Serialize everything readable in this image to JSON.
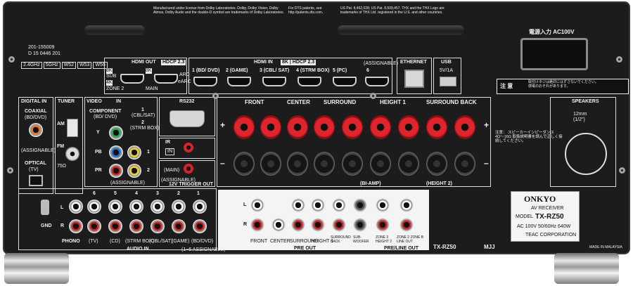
{
  "top": {
    "cert_id": "201-155009",
    "cert_id2": "D 15 0446 201",
    "dolby_notice": "Manufactured under license from Dolby Laboratories. Dolby, Dolby Vision, Dolby Atmos, Dolby Audio and the double-D symbol are trademarks of Dolby Laboratories.",
    "dts_notice": "For DTS patents, see http://patents.dts.com.",
    "thx_notice": "US Pat. 8,462,028; US Pat. 8,509,457. THX and the THX Logo are trademarks of THX Ltd. registered in the U.S. and other countries.",
    "wifi_badges": [
      "2.4GHz",
      "5GHz",
      "W52",
      "W53",
      "W56"
    ]
  },
  "hdmi_out": {
    "label": "HDMI OUT",
    "hdcp": "HDCP 2.3",
    "port_sub": [
      "8K",
      "SUB",
      "4K",
      "ZONE 2"
    ],
    "port_main": [
      "8K",
      "MAIN",
      "ARC",
      "eARC"
    ]
  },
  "hdmi_in": {
    "label": "HDMI IN",
    "tag": "8K | HDCP 2.3",
    "assignable": "(ASSIGNABLE)",
    "ports": [
      "1 (BD/ DVD)",
      "2 (GAME)",
      "3 (CBL/ SAT)",
      "4 (STRM BOX)",
      "5 (PC)",
      "6"
    ]
  },
  "ethernet": {
    "label": "ETHERNET"
  },
  "usb": {
    "label": "USB",
    "rating": "5V/1A"
  },
  "power": {
    "label": "電源入力 AC100V"
  },
  "caution": {
    "title": "注 意",
    "text": "取付けネジは絶対にはずさないでください。感電のおそれがあります。"
  },
  "digital_in": {
    "label": "DIGITAL IN",
    "coaxial": "COAXIAL",
    "coaxial_sub": "(BD/DVD)",
    "assignable": "(ASSIGNABLE)",
    "optical": "OPTICAL",
    "optical_sub": "(TV)"
  },
  "tuner": {
    "label": "TUNER",
    "am": "AM",
    "fm": "FM",
    "ohm": "75Ω"
  },
  "video_in": {
    "label": "VIDEO",
    "label2": "IN",
    "component": "COMPONENT",
    "component_sub": "(BD/ DVD)",
    "in1": "1",
    "in1_sub": "(CBL/SAT)",
    "in2": "2",
    "in2_sub": "(STRM BOX)",
    "y": "Y",
    "pb": "PB",
    "pr": "PR",
    "one": "1",
    "two": "2",
    "assignable": "(ASSIGNABLE)"
  },
  "rs232": {
    "label": "RS232"
  },
  "ir": {
    "label": "IR",
    "in": "IN"
  },
  "trigger": {
    "main": "(MAIN)",
    "assignable": "(ASSIGNABLE)",
    "label": "12V TRIGGER OUT"
  },
  "speakers": {
    "front": "FRONT",
    "center": "CENTER",
    "surround": "SURROUND",
    "height1": "HEIGHT 1",
    "surround_back": "SURROUND BACK",
    "r": "R",
    "l": "L",
    "plus": "+",
    "minus": "–",
    "biamp": "(BI-AMP)",
    "height2": "(HEIGHT 2)",
    "title": "SPEAKERS",
    "wire": "12mm (1/2\")",
    "note": "注意： スピーカーインピーダンス 4Ω〜16Ω 取扱説明書を読んで正しく接続してください。"
  },
  "audio_in": {
    "label": "AUDIO IN",
    "assignable": "(1~6 ASSIGNABLE)",
    "phono": "PHONO",
    "gnd": "GND",
    "numbers": [
      "6",
      "5",
      "4",
      "3",
      "2",
      "1"
    ],
    "names": [
      "(TV)",
      "(CD)",
      "(STRM BOX)",
      "(CBL/SAT)",
      "(GAME)",
      "(BD/DVD)"
    ],
    "l": "L",
    "r": "R"
  },
  "pre_out": {
    "label": "PRE OUT",
    "line_label": "PRE/LINE OUT",
    "channels": [
      "FRONT",
      "CENTER",
      "SURROUND",
      "HEIGHT 1",
      "SURROUND BACK",
      "SUB-WOOFER",
      "ZONE 3 HEIGHT 2",
      "ZONE 2 ZONE B LINE OUT"
    ]
  },
  "model_bottom": "TX-RZ50",
  "mjj": "MJJ",
  "nameplate": {
    "brand": "ONKYO",
    "type": "AV RECEIVER",
    "model_label": "MODEL",
    "model": "TX-RZ50",
    "rating": "AC 100V  50/60Hz  640W",
    "maker": "TEAC CORPORATION",
    "origin": "MADE IN MALAYSIA"
  },
  "colors": {
    "chassis": "#1c1c1d",
    "speaker_red": "#e0242b",
    "label": "#f2f2f2"
  }
}
